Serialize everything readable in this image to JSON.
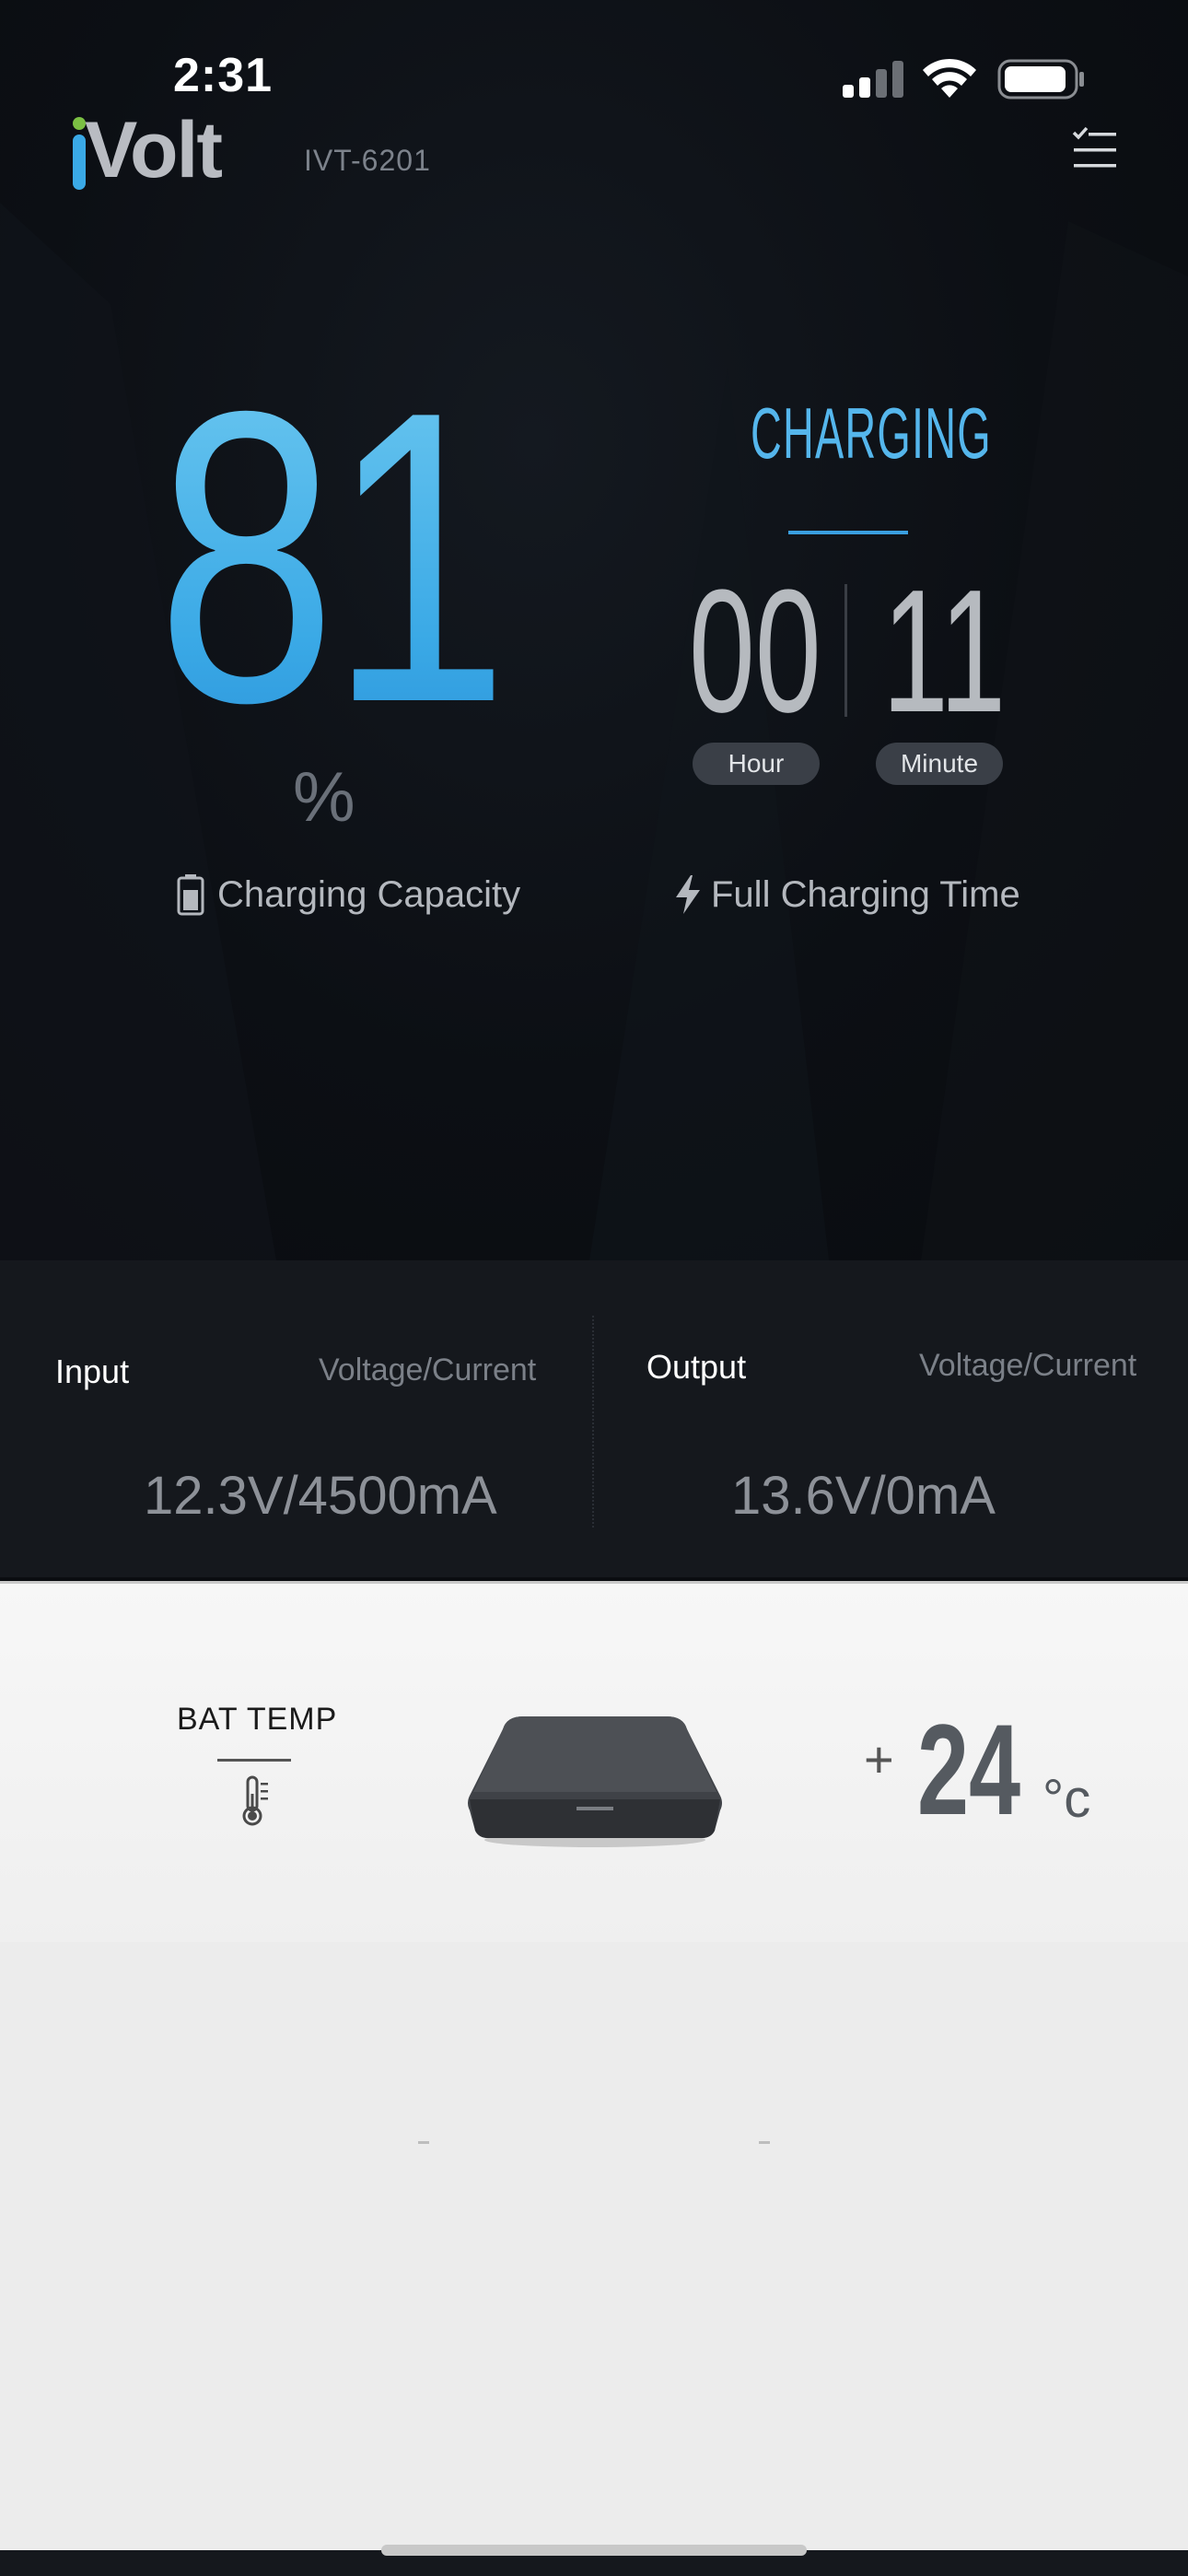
{
  "status_bar": {
    "time": "2:31"
  },
  "header": {
    "logo_text": "Volt",
    "device_id": "IVT-6201"
  },
  "charge": {
    "percent": "81",
    "percent_unit": "%",
    "capacity_label": "Charging Capacity",
    "state_label": "CHARGING",
    "hours": "00",
    "minutes": "11",
    "hour_label": "Hour",
    "minute_label": "Minute",
    "time_label": "Full Charging Time"
  },
  "io": {
    "input_label": "Input",
    "input_sub": "Voltage/Current",
    "input_value": "12.3V/4500mA",
    "output_label": "Output",
    "output_sub": "Voltage/Current",
    "output_value": "13.6V/0mA"
  },
  "temperature": {
    "label": "BAT TEMP",
    "sign": "+",
    "value": "24",
    "unit": "°c"
  },
  "colors": {
    "accent": "#3aa9e6",
    "background": "#0b0d11",
    "panel": "#15181d",
    "light_panel": "#f2f2f2"
  }
}
